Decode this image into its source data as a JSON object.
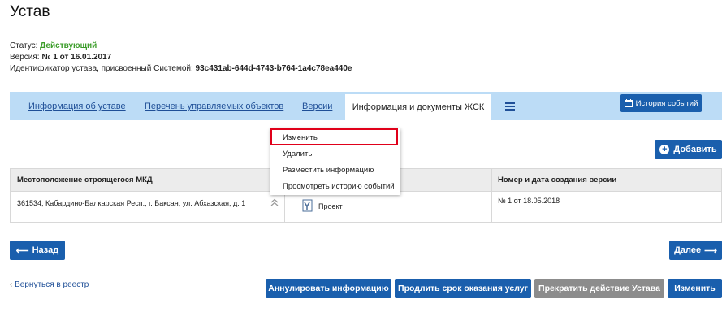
{
  "page": {
    "title": "Устав"
  },
  "meta": {
    "status_label": "Статус:",
    "status_value": "Действующий",
    "version_label": "Версия:",
    "version_value": "№ 1 от 16.01.2017",
    "id_label": "Идентификатор устава, присвоенный Системой:",
    "id_value": "93c431ab-644d-4743-b764-1a4c78ea440e"
  },
  "tabs": [
    {
      "label": "Информация об уставе"
    },
    {
      "label": "Перечень управляемых объектов"
    },
    {
      "label": "Версии"
    },
    {
      "label": "Информация и документы ЖСК",
      "active": true
    }
  ],
  "history_button": "История событий",
  "dropdown": {
    "items": [
      "Изменить",
      "Удалить",
      "Разместить информацию",
      "Просмотреть историю событий"
    ]
  },
  "add_button": "Добавить",
  "table": {
    "headers": [
      "Местоположение строящегося МКД",
      "",
      "Номер и дата создания версии"
    ],
    "row": {
      "location": "361534, Кабардино-Балкарская Респ., г. Баксан, ул. Абхазская, д. 1",
      "status": "Проект",
      "version": "№ 1 от 18.05.2018"
    }
  },
  "nav": {
    "back": "Назад",
    "next": "Далее"
  },
  "footer": {
    "back_link": "Вернуться в реестр",
    "buttons": [
      "Аннулировать информацию",
      "Продлить срок оказания услуг",
      "Прекратить действие Устава",
      "Изменить"
    ]
  },
  "colors": {
    "accent": "#1a5fad",
    "status_green": "#3a9c28",
    "tab_bar": "#bcdcf6",
    "highlight": "#e0001a"
  }
}
